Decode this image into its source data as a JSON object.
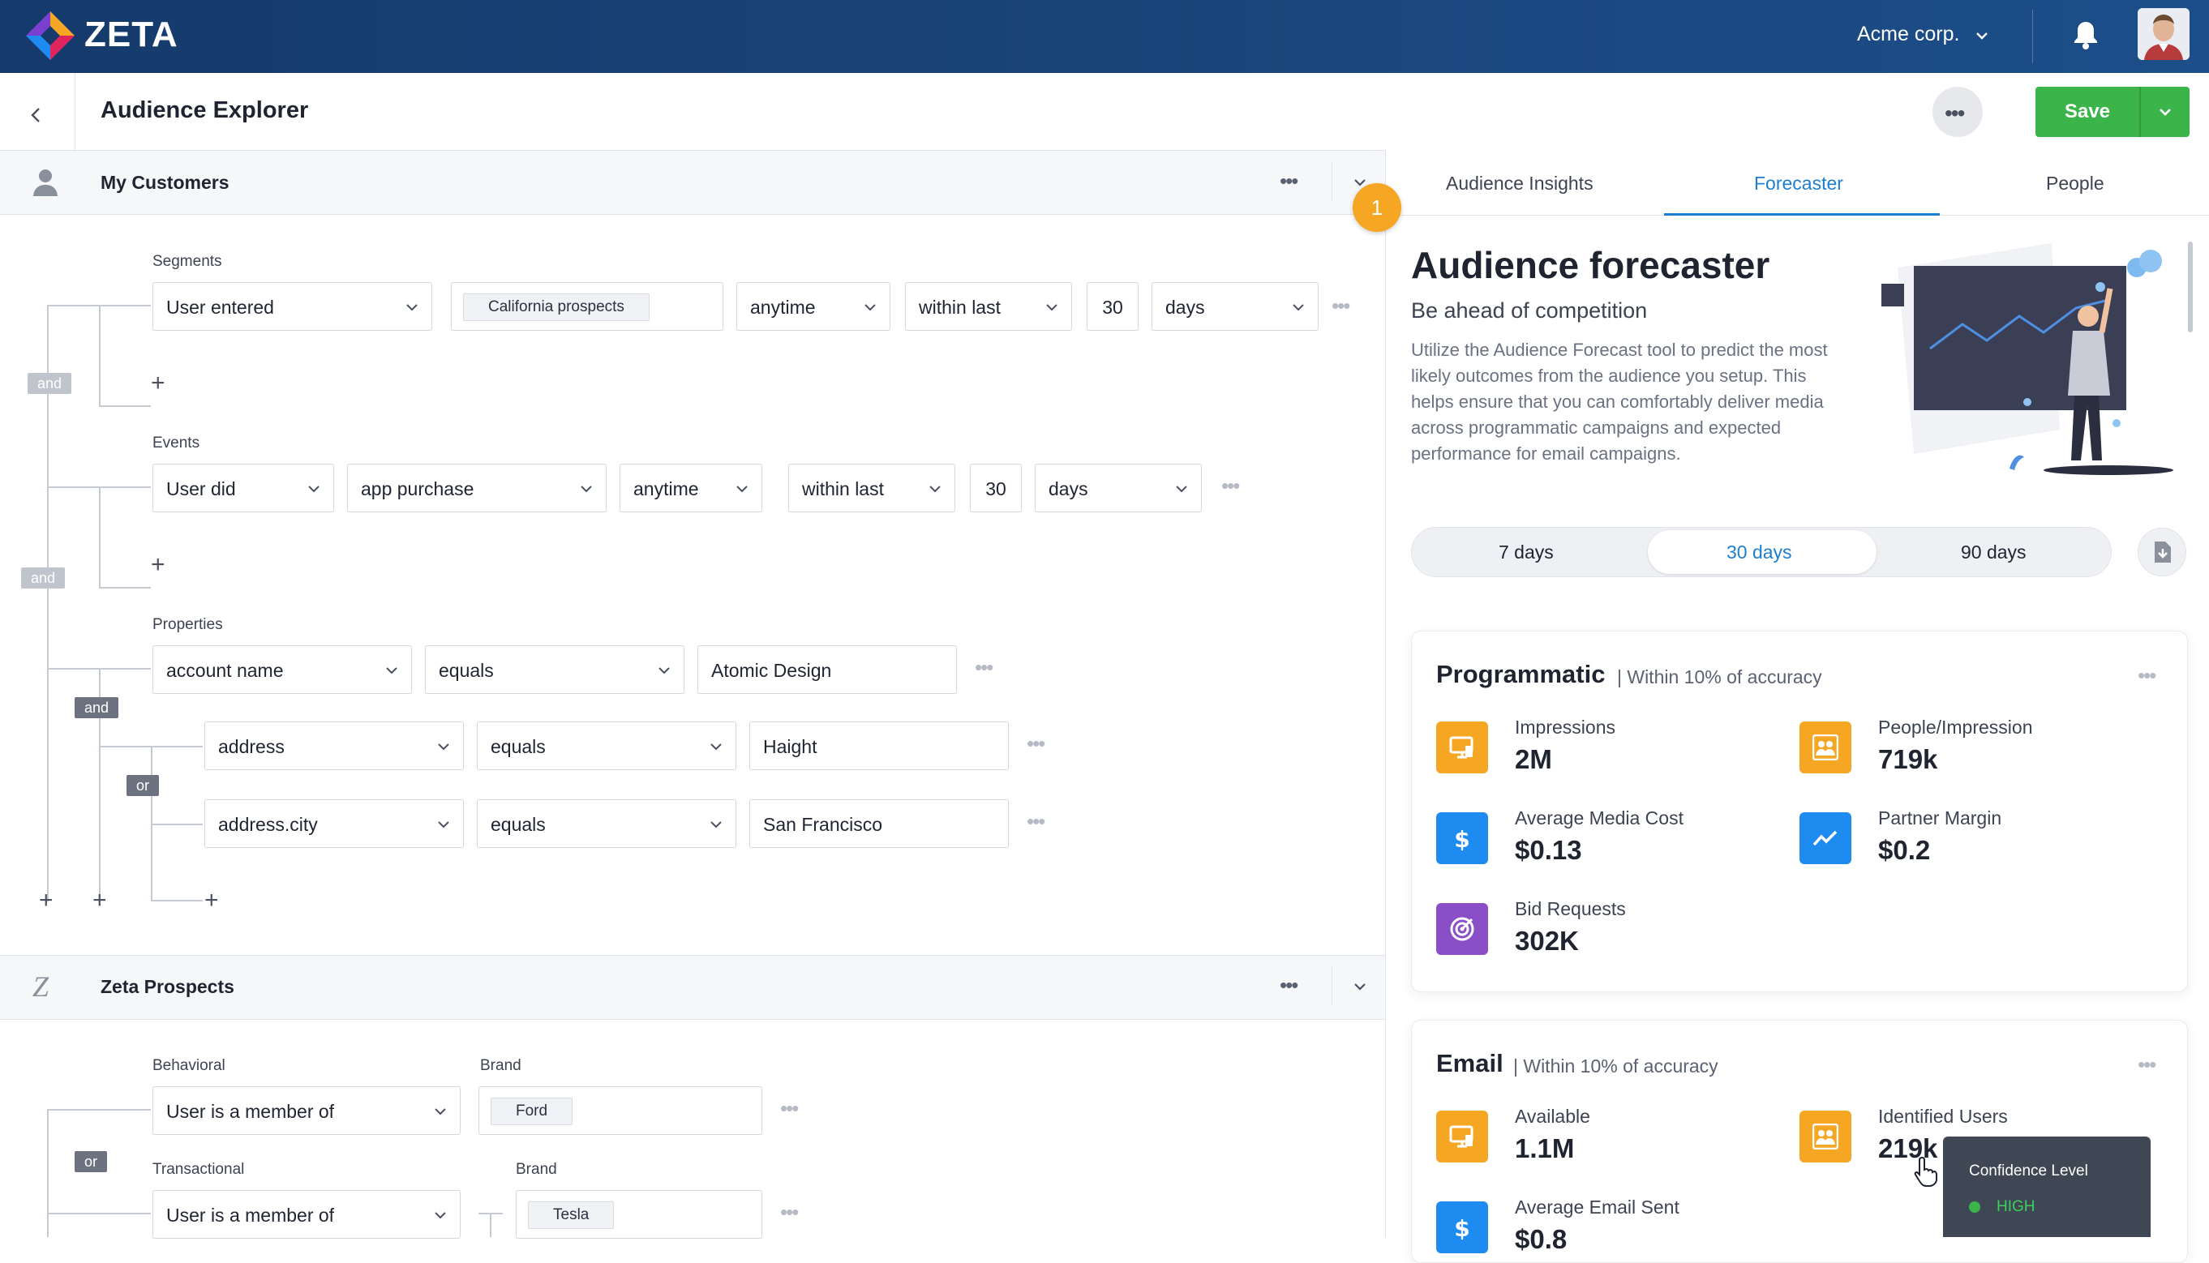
{
  "app": {
    "brand": "ZETA",
    "org": "Acme corp.",
    "page_title": "Audience Explorer",
    "save_label": "Save"
  },
  "my_customers": {
    "title": "My Customers",
    "segments": {
      "label": "Segments",
      "op": "User entered",
      "chip": "California prospects",
      "time": "anytime",
      "window": "within last",
      "count": "30",
      "unit": "days"
    },
    "events": {
      "label": "Events",
      "op": "User did",
      "event": "app purchase",
      "time": "anytime",
      "window": "within last",
      "count": "30",
      "unit": "days"
    },
    "properties": {
      "label": "Properties",
      "rows": [
        {
          "field": "account name",
          "op": "equals",
          "value": "Atomic Design"
        },
        {
          "field": "address",
          "op": "equals",
          "value": "Haight"
        },
        {
          "field": "address.city",
          "op": "equals",
          "value": "San Francisco"
        }
      ]
    },
    "and_tag": "and",
    "or_tag": "or"
  },
  "zeta_prospects": {
    "title": "Zeta Prospects",
    "behavioral": {
      "label": "Behavioral",
      "op": "User is a member of",
      "brand_label": "Brand",
      "brand": "Ford"
    },
    "transactional": {
      "label": "Transactional",
      "op": "User is a member of",
      "brand_label": "Brand",
      "brand": "Tesla"
    },
    "or_tag": "or"
  },
  "badge": "1",
  "tabs": [
    "Audience Insights",
    "Forecaster",
    "People"
  ],
  "forecaster": {
    "title": "Audience forecaster",
    "subtitle": "Be ahead of competition",
    "description": "Utilize the Audience Forecast tool to predict the most likely outcomes from the audience you setup. This helps ensure that you can comfortably deliver media across programmatic campaigns and expected performance for email campaigns.",
    "ranges": [
      "7 days",
      "30 days",
      "90 days"
    ],
    "selected_range": "30 days"
  },
  "programmatic": {
    "title": "Programmatic",
    "accuracy": "| Within 10% of accuracy",
    "metrics": [
      {
        "label": "Impressions",
        "value": "2M",
        "icon": "monitor-icon"
      },
      {
        "label": "People/Impression",
        "value": "719k",
        "icon": "people-icon"
      },
      {
        "label": "Average Media Cost",
        "value": "$0.13",
        "icon": "dollar-icon"
      },
      {
        "label": "Partner Margin",
        "value": "$0.2",
        "icon": "trend-icon"
      },
      {
        "label": "Bid Requests",
        "value": "302K",
        "icon": "target-icon"
      }
    ]
  },
  "email": {
    "title": "Email",
    "accuracy": "| Within 10% of accuracy",
    "metrics": [
      {
        "label": "Available",
        "value": "1.1M",
        "icon": "monitor-icon"
      },
      {
        "label": "Identified Users",
        "value": "219k",
        "icon": "people-icon"
      },
      {
        "label": "Average Email Sent",
        "value": "$0.8",
        "icon": "dollar-icon"
      }
    ]
  },
  "tooltip": {
    "title": "Confidence Level",
    "level": "HIGH"
  },
  "colors": {
    "brand_bar": "#1d4e89",
    "accent": "#1d7fd1",
    "save": "#3bb54a",
    "badge": "#f5a623",
    "metric_orange": "#f5a623",
    "metric_blue": "#1d8bf0",
    "metric_purple": "#8a4fc7"
  }
}
